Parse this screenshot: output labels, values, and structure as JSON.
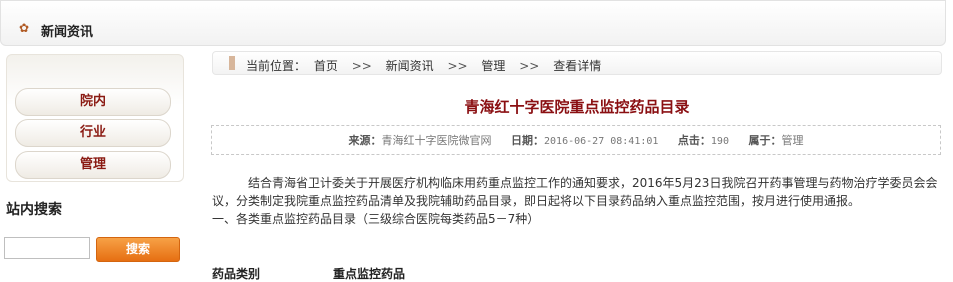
{
  "header": {
    "title": "新闻资讯",
    "icon": "gear-icon"
  },
  "sidebar": {
    "items": [
      {
        "label": "院内"
      },
      {
        "label": "行业"
      },
      {
        "label": "管理"
      }
    ],
    "search": {
      "title": "站内搜索",
      "input_value": "",
      "button_label": "搜索"
    }
  },
  "breadcrumb": {
    "prefix": "当前位置：",
    "items": [
      "首页",
      "新闻资讯",
      "管理",
      "查看详情"
    ],
    "separator": ">>"
  },
  "article": {
    "title": "青海红十字医院重点监控药品目录",
    "meta": {
      "source_label": "来源：",
      "source_value": "青海红十字医院微官网",
      "date_label": "日期：",
      "date_value": "2016-06-27 08:41:01",
      "clicks_label": "点击：",
      "clicks_value": "190",
      "category_label": "属于：",
      "category_value": "管理"
    },
    "paragraph1": "结合青海省卫计委关于开展医疗机构临床用药重点监控工作的通知要求，2016年5月23日我院召开药事管理与药物治疗学委员会会议，分类制定我院重点监控药品清单及我院辅助药品目录，即日起将以下目录药品纳入重点监控范围，按月进行使用通报。",
    "paragraph2": "一、各类重点监控药品目录（三级综合医院每类药品5－7种）",
    "table_headers": [
      "药品类别",
      "重点监控药品"
    ]
  },
  "colors": {
    "title_red": "#8a0f12",
    "button_orange": "#e66f12"
  }
}
